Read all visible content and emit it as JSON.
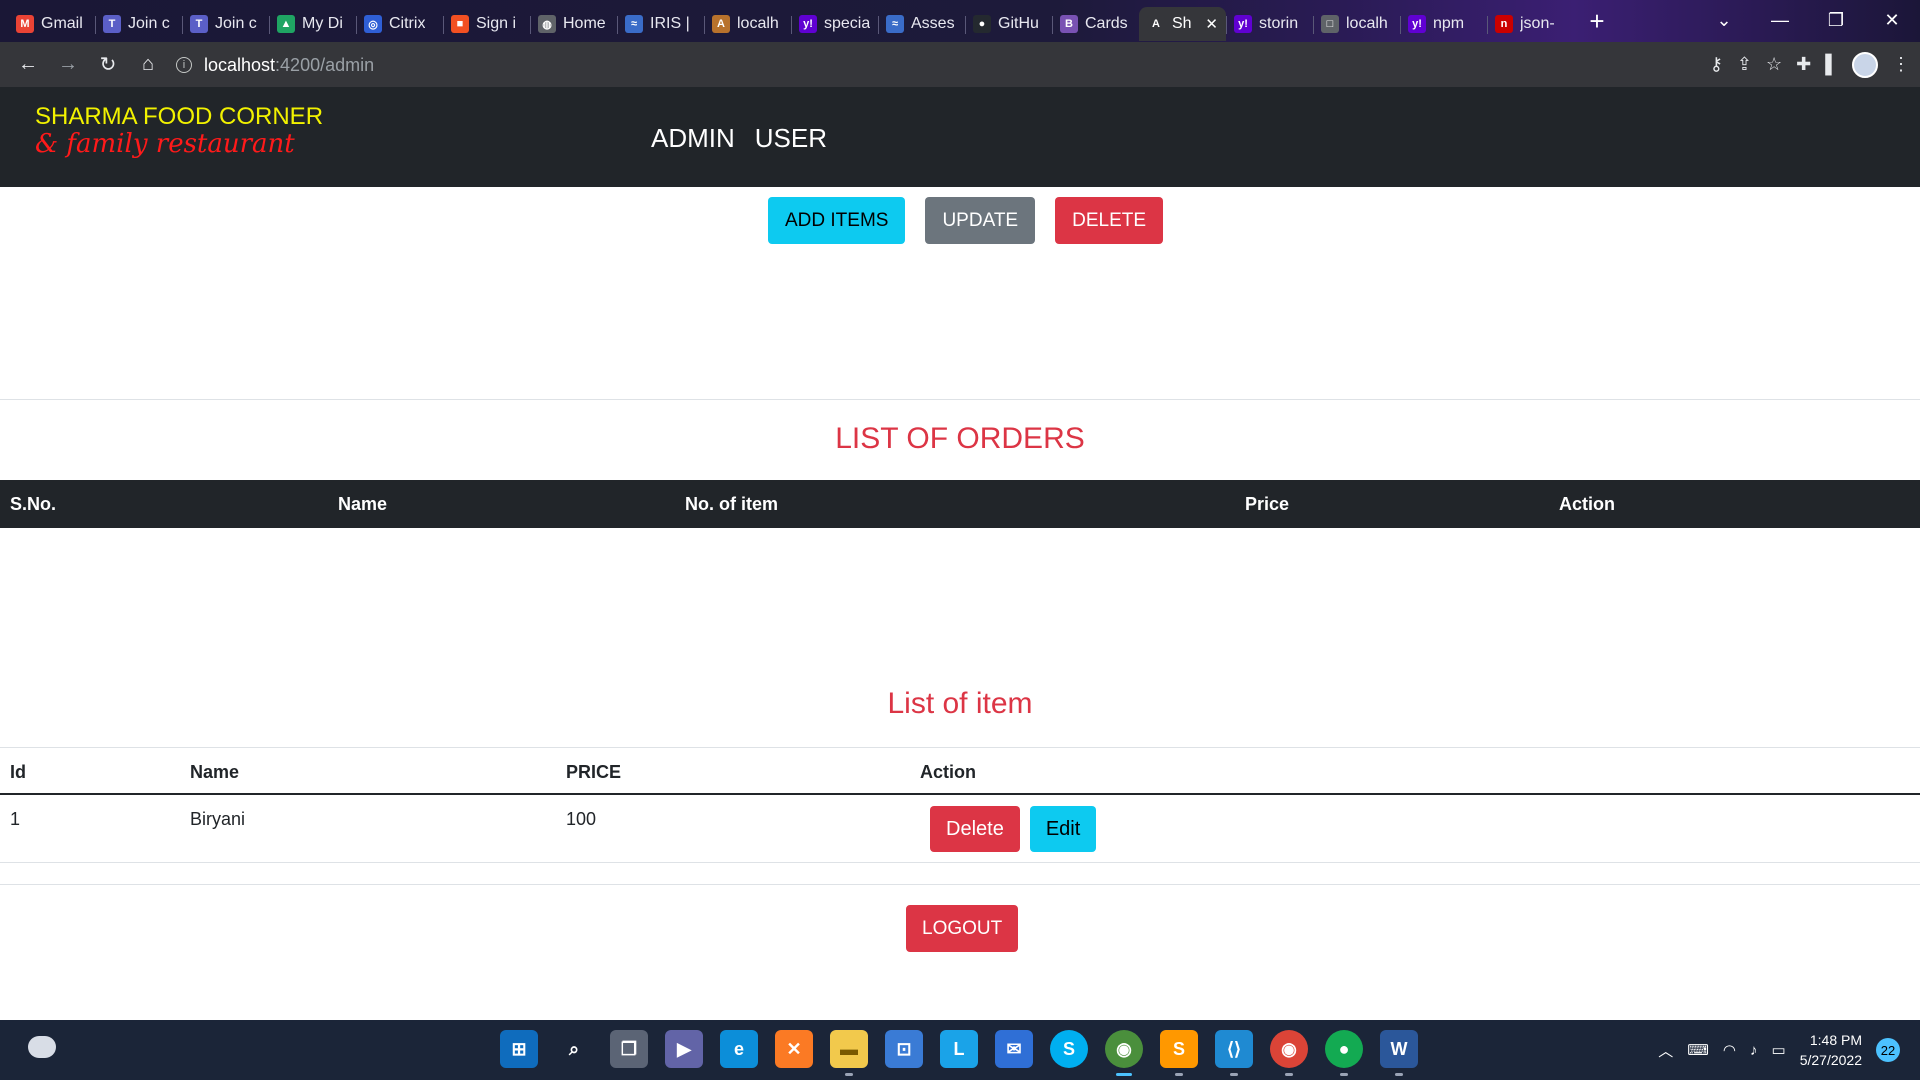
{
  "browser": {
    "tabs": [
      {
        "label": "Gmail",
        "icon": "gmail-icon",
        "color": "#ea4335",
        "glyph": "M"
      },
      {
        "label": "Join c",
        "icon": "teams-icon",
        "color": "#5b5fc7",
        "glyph": "T"
      },
      {
        "label": "Join c",
        "icon": "teams-icon",
        "color": "#5b5fc7",
        "glyph": "T"
      },
      {
        "label": "My Di",
        "icon": "drive-icon",
        "color": "#1fa463",
        "glyph": "▲"
      },
      {
        "label": "Citrix",
        "icon": "citrix-icon",
        "color": "#2f5fd6",
        "glyph": "◎"
      },
      {
        "label": "Sign i",
        "icon": "microsoft-icon",
        "color": "#f25022",
        "glyph": "■"
      },
      {
        "label": "Home",
        "icon": "globe-icon",
        "color": "#5f6368",
        "glyph": "◍"
      },
      {
        "label": "IRIS | ",
        "icon": "iris-icon",
        "color": "#3a6cc8",
        "glyph": "≈"
      },
      {
        "label": "localh",
        "icon": "angular-icon",
        "color": "#b8722c",
        "glyph": "A"
      },
      {
        "label": "specia",
        "icon": "yahoo-icon",
        "color": "#6001d2",
        "glyph": "y!"
      },
      {
        "label": "Asses",
        "icon": "iris-icon",
        "color": "#3a6cc8",
        "glyph": "≈"
      },
      {
        "label": "GitHu",
        "icon": "github-icon",
        "color": "#24292f",
        "glyph": "●"
      },
      {
        "label": "Cards",
        "icon": "bootstrap-icon",
        "color": "#7952b3",
        "glyph": "B"
      },
      {
        "label": "Sh",
        "icon": "angular-icon",
        "color": "#35363a",
        "glyph": "A",
        "active": true
      },
      {
        "label": "storin",
        "icon": "yahoo-icon",
        "color": "#6001d2",
        "glyph": "y!"
      },
      {
        "label": "localh",
        "icon": "page-icon",
        "color": "#5f6368",
        "glyph": "□"
      },
      {
        "label": "npm",
        "icon": "yahoo-icon",
        "color": "#6001d2",
        "glyph": "y!"
      },
      {
        "label": "json-",
        "icon": "npm-icon",
        "color": "#cb0000",
        "glyph": "n"
      }
    ],
    "address": {
      "host": "localhost",
      "path": ":4200/admin"
    }
  },
  "header": {
    "brand_title": "SHARMA FOOD CORNER",
    "brand_subtitle": "& family restaurant",
    "nav": {
      "admin": "ADMIN",
      "user": "USER"
    }
  },
  "admin_actions": {
    "add": "ADD ITEMS",
    "update": "UPDATE",
    "delete": "DELETE"
  },
  "orders": {
    "title": "LIST OF ORDERS",
    "columns": {
      "sno": "S.No.",
      "name": "Name",
      "count": "No. of item",
      "price": "Price",
      "action": "Action"
    }
  },
  "items": {
    "title": "List of item",
    "columns": {
      "id": "Id",
      "name": "Name",
      "price": "PRICE",
      "action": "Action"
    },
    "rows": [
      {
        "id": "1",
        "name": "Biryani",
        "price": "100",
        "delete_label": "Delete",
        "edit_label": "Edit"
      }
    ]
  },
  "logout_label": "LOGOUT",
  "taskbar": {
    "time": "1:48 PM",
    "date": "5/27/2022",
    "notifications": "22"
  },
  "colors": {
    "danger": "#dc3545",
    "info": "#0dcaf0",
    "secondary": "#6c757d",
    "dark": "#212529",
    "brand_yellow": "#f2f200",
    "brand_red": "#ff1a1a"
  }
}
